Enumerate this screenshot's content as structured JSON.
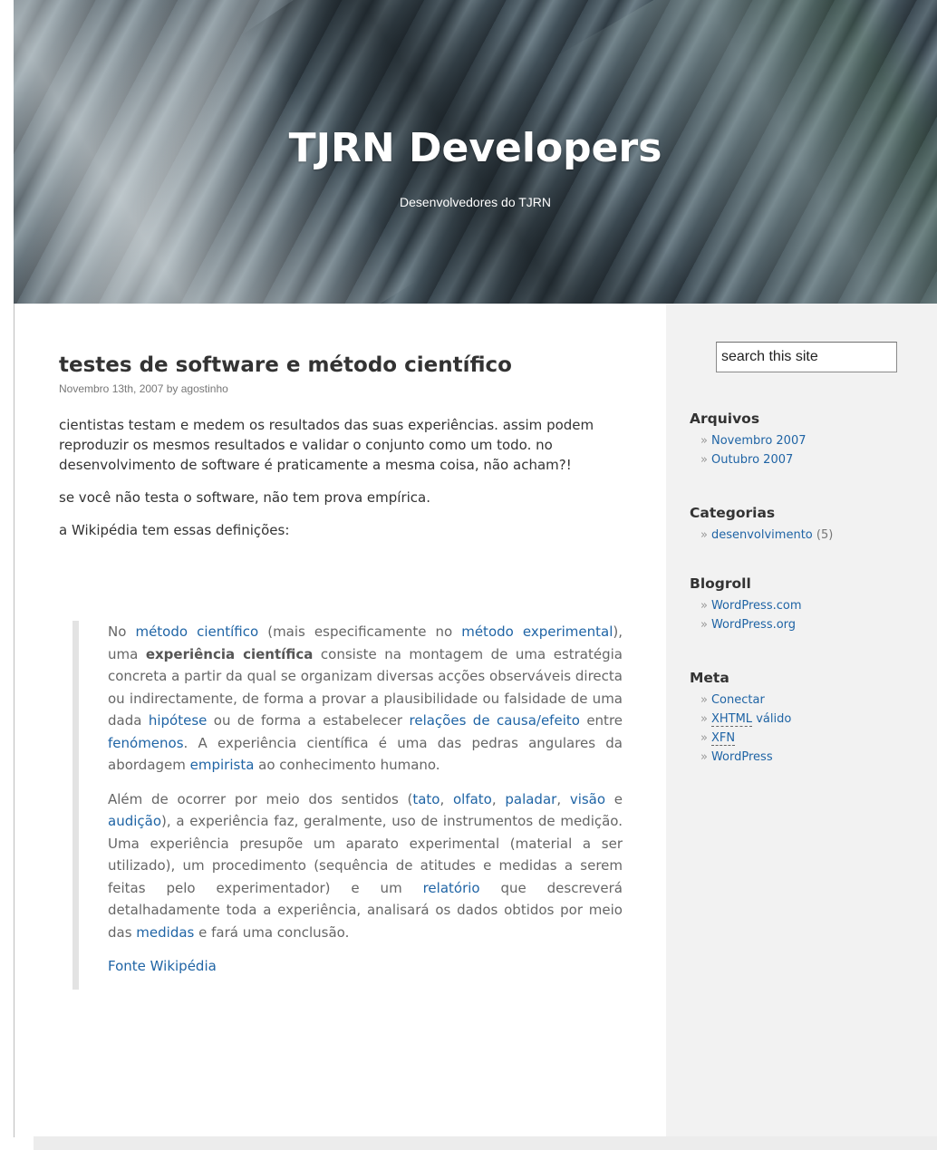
{
  "header": {
    "title": "TJRN Developers",
    "description": "Desenvolvedores do TJRN"
  },
  "post": {
    "title": "testes de software e método científico",
    "meta": "Novembro 13th, 2007 by agostinho",
    "paragraphs": [
      "cientistas testam e medem os resultados das suas experiências. assim podem reproduzir os mesmos resultados e validar o conjunto como um todo. no desenvolvimento de software é praticamente a mesma coisa, não acham?!",
      "se você não testa o software, não tem prova empírica.",
      "a Wikipédia tem essas definições:"
    ],
    "quote": {
      "p1": {
        "t1": "No ",
        "l1": "método científico",
        "t2": " (mais especificamente no ",
        "l2": "método experimental",
        "t3": "), uma ",
        "b1": "experiência científica",
        "t4": " consiste na montagem de uma estratégia concreta a partir da qual se organizam diversas acções observáveis directa ou indirectamente, de forma a provar a plausibilidade ou falsidade de uma dada ",
        "l3": "hipótese",
        "t5": " ou de forma a estabelecer ",
        "l4": "relações de causa/efeito",
        "t6": " entre ",
        "l5": "fenómenos",
        "t7": ". A experiência científica é uma das pedras angulares da abordagem ",
        "l6": "empirista",
        "t8": " ao conhecimento humano."
      },
      "p2": {
        "t1": "Além de ocorrer por meio dos sentidos (",
        "l1": "tato",
        "t2": ", ",
        "l2": "olfato",
        "t3": ", ",
        "l3": "paladar",
        "t4": ", ",
        "l4": "visão",
        "t5": " e ",
        "l5": "audição",
        "t6": "), a experiência faz, geralmente, uso de instrumentos de medição. Uma experiência presupõe um aparato experimental (material a ser utilizado), um procedimento (sequência de atitudes e medidas a serem feitas pelo experimentador) e um ",
        "l6": "relatório",
        "t7": " que descreverá detalhadamente toda a experiência, analisará os dados obtidos por meio das ",
        "l7": "medidas",
        "t8": " e fará uma conclusão."
      },
      "source": "Fonte Wikipédia"
    }
  },
  "sidebar": {
    "search_value": "search this site",
    "bullet": "»",
    "arquivos": {
      "title": "Arquivos",
      "items": [
        "Novembro 2007",
        "Outubro 2007"
      ]
    },
    "categorias": {
      "title": "Categorias",
      "item_label": "desenvolvimento",
      "item_count": "(5)"
    },
    "blogroll": {
      "title": "Blogroll",
      "items": [
        "WordPress.com",
        "WordPress.org"
      ]
    },
    "meta": {
      "title": "Meta",
      "conectar": "Conectar",
      "xhtml_abbr": "XHTML",
      "xhtml_rest": " válido",
      "xfn": "XFN",
      "wordpress": "WordPress"
    }
  }
}
